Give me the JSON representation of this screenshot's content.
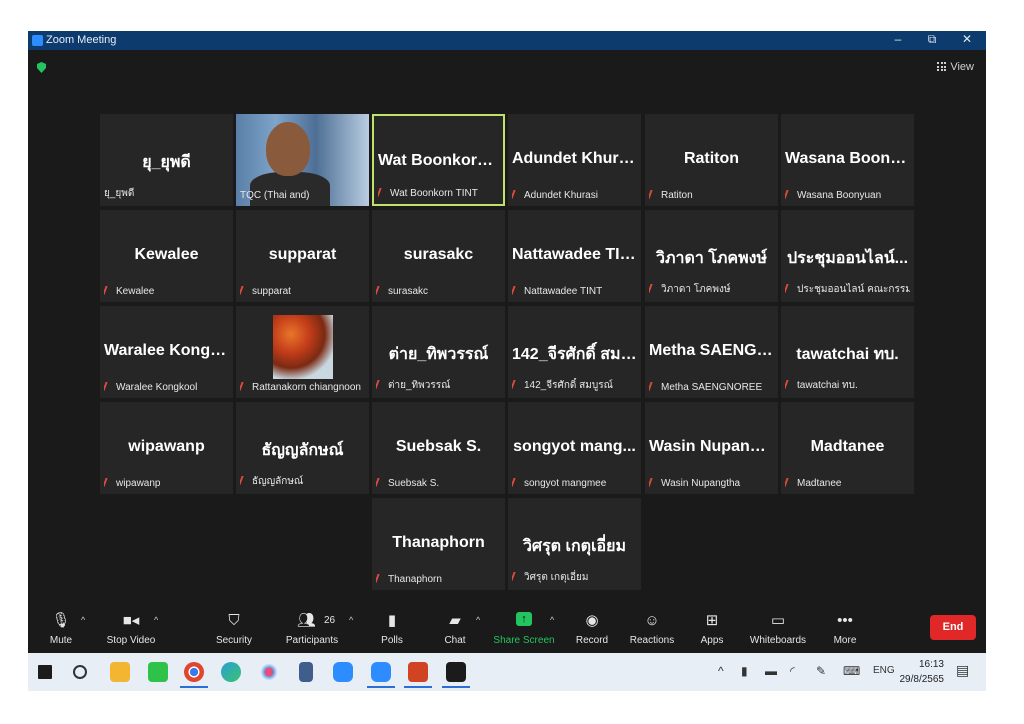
{
  "window": {
    "title": "Zoom Meeting",
    "controls": {
      "minimize": "–",
      "maximize": "⧉",
      "close": "✕"
    }
  },
  "topbar": {
    "view_label": "View"
  },
  "tiles": [
    {
      "big": "ยุ_ยุพดี",
      "small": "ยุ_ยุพดี",
      "muted": false
    },
    {
      "big": "",
      "small": "TQC (Thai and)",
      "muted": false,
      "video": true
    },
    {
      "big": "Wat Boonkorn....",
      "small": "Wat Boonkorn TINT",
      "muted": true,
      "active": true
    },
    {
      "big": "Adundet Khurasi",
      "small": "Adundet Khurasi",
      "muted": true
    },
    {
      "big": "Ratiton",
      "small": "Ratiton",
      "muted": true
    },
    {
      "big": "Wasana Boonyu...",
      "small": "Wasana Boonyuan",
      "muted": true
    },
    {
      "big": "Kewalee",
      "small": "Kewalee",
      "muted": true
    },
    {
      "big": "supparat",
      "small": "supparat",
      "muted": true
    },
    {
      "big": "surasakc",
      "small": "surasakc",
      "muted": true
    },
    {
      "big": "Nattawadee TINT",
      "small": "Nattawadee TINT",
      "muted": true
    },
    {
      "big": "วิภาดา โภคพงษ์",
      "small": "วิภาดา โภคพงษ์",
      "muted": true
    },
    {
      "big": "ประชุมออนไลน์...",
      "small": "ประชุมออนไลน์ คณะกรรมการ..",
      "muted": true
    },
    {
      "big": "Waralee Kongk...",
      "small": "Waralee Kongkool",
      "muted": true
    },
    {
      "big": "",
      "small": "Rattanakorn chiangnoon",
      "muted": true,
      "image": true
    },
    {
      "big": "ต่าย_ทิพวรรณ์",
      "small": "ต่าย_ทิพวรรณ์",
      "muted": true
    },
    {
      "big": "142_จีรศักดิ์ สมบู...",
      "small": "142_จีรศักดิ์ สมบูรณ์",
      "muted": true
    },
    {
      "big": "Metha SAENGN...",
      "small": "Metha SAENGNOREE",
      "muted": true
    },
    {
      "big": "tawatchai ทบ.",
      "small": "tawatchai ทบ.",
      "muted": true
    },
    {
      "big": "wipawanp",
      "small": "wipawanp",
      "muted": true
    },
    {
      "big": "ธัญญลักษณ์",
      "small": "ธัญญลักษณ์",
      "muted": true
    },
    {
      "big": "Suebsak S.",
      "small": "Suebsak S.",
      "muted": true
    },
    {
      "big": "songyot mang...",
      "small": "songyot mangmee",
      "muted": true
    },
    {
      "big": "Wasin Nupangtha",
      "small": "Wasin Nupangtha",
      "muted": true
    },
    {
      "big": "Madtanee",
      "small": "Madtanee",
      "muted": true
    },
    {
      "big": "Thanaphorn",
      "small": "Thanaphorn",
      "muted": true
    },
    {
      "big": "วิศรุต เกตุเอี่ยม",
      "small": "วิศรุต เกตุเอี่ยม",
      "muted": true
    }
  ],
  "toolbar": {
    "mute": "Mute",
    "stop_video": "Stop Video",
    "security": "Security",
    "participants": "Participants",
    "participants_count": "26",
    "polls": "Polls",
    "chat": "Chat",
    "share_screen": "Share Screen",
    "record": "Record",
    "reactions": "Reactions",
    "apps": "Apps",
    "whiteboards": "Whiteboards",
    "more": "More",
    "end": "End"
  },
  "taskbar": {
    "apps": [
      "windows-start",
      "search",
      "file-explorer",
      "line",
      "chrome",
      "edge",
      "paint",
      "calculator",
      "zoom-meetings",
      "zoom",
      "powerpoint",
      "acrobat"
    ],
    "language": "ENG",
    "time": "16:13",
    "date": "29/8/2565"
  },
  "colors": {
    "titlebar": "#0d3b6e",
    "active_speaker_border": "#bfe26a",
    "share_green": "#23c55e",
    "end_red": "#e02828",
    "muted_red": "#e04a3c"
  }
}
